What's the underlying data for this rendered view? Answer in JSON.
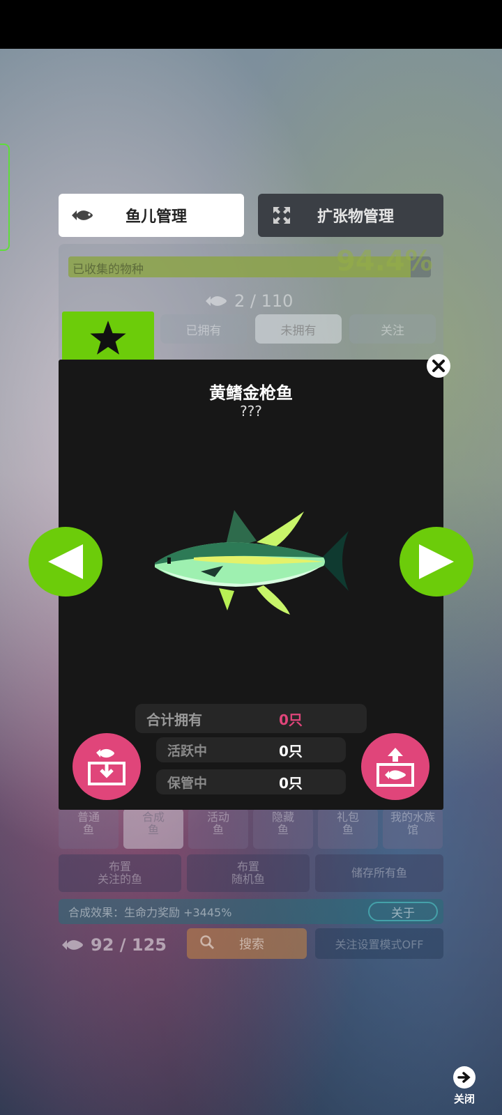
{
  "tabs": {
    "fish_management": "鱼儿管理",
    "expansion_management": "扩张物管理"
  },
  "collection": {
    "progress_label": "已收集的物种",
    "progress_prefix": "",
    "percent_text": "94.4%",
    "progress_value": 0.944,
    "owned_text": "2 / 110"
  },
  "filters": {
    "owned": "已拥有",
    "not_owned": "未拥有",
    "followed": "关注"
  },
  "fish": {
    "name": "黄鳍金枪鱼",
    "subtitle": "???"
  },
  "stats": {
    "total_label": "合计拥有",
    "total_value": "0只",
    "active_label": "活跃中",
    "active_value": "0只",
    "stored_label": "保管中",
    "stored_value": "0只"
  },
  "categories": [
    {
      "line1": "普通",
      "line2": "鱼"
    },
    {
      "line1": "合成",
      "line2": "鱼"
    },
    {
      "line1": "活动",
      "line2": "鱼"
    },
    {
      "line1": "隐藏",
      "line2": "鱼"
    },
    {
      "line1": "礼包",
      "line2": "鱼"
    },
    {
      "line1": "我的水族",
      "line2": "馆"
    }
  ],
  "actions": {
    "place_followed_1": "布置",
    "place_followed_2": "关注的鱼",
    "place_random_1": "布置",
    "place_random_2": "随机鱼",
    "store_all": "储存所有鱼"
  },
  "synthesis": {
    "effect_text": "合成效果：生命力奖励 +3445%",
    "about_label": "关于"
  },
  "footer": {
    "total_text": "92 / 125",
    "search_label": "搜索",
    "follow_mode": "关注设置模式OFF",
    "close_label": "关闭"
  },
  "colors": {
    "accent_green": "#6ccc0a",
    "pink": "#e0457a",
    "modal_bg": "#171717"
  }
}
